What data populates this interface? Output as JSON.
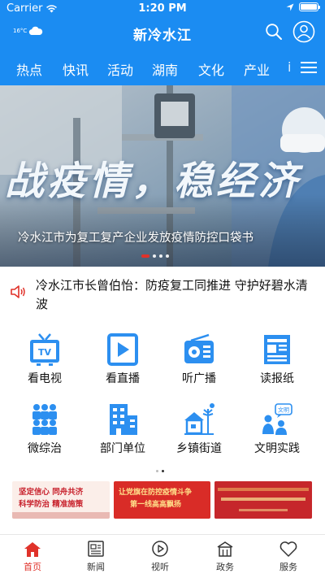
{
  "status_bar": {
    "carrier": "Carrier",
    "time": "1:20 PM",
    "battery_level": 1.0
  },
  "header": {
    "weather_temp": "16°C",
    "title": "新冷水江"
  },
  "tabs": [
    "热点",
    "快讯",
    "活动",
    "湖南",
    "文化",
    "产业",
    "i"
  ],
  "banner": {
    "slogan": "战疫情，稳经济",
    "caption": "冷水江市为复工复产企业发放疫情防控口袋书",
    "slides": 5,
    "active_slide": 1
  },
  "notice": {
    "text": "冷水江市长曾伯怡：防疫复工同推进 守护好碧水清波"
  },
  "grid": [
    {
      "label": "看电视",
      "icon": "tv-icon"
    },
    {
      "label": "看直播",
      "icon": "live-play-icon"
    },
    {
      "label": "听广播",
      "icon": "radio-icon"
    },
    {
      "label": "读报纸",
      "icon": "newspaper-icon"
    },
    {
      "label": "微综治",
      "icon": "people-icon"
    },
    {
      "label": "部门单位",
      "icon": "building-icon"
    },
    {
      "label": "乡镇街道",
      "icon": "town-icon"
    },
    {
      "label": "文明实践",
      "icon": "civilization-icon"
    }
  ],
  "ads": [
    {
      "line1": "坚定信心 同舟共济",
      "line2": "科学防治 精准施策"
    },
    {
      "line1": "让党旗在防控疫情斗争",
      "line2": "第一线高高飘扬"
    },
    {
      "line1": "",
      "line2": ""
    }
  ],
  "bottom_tabs": [
    {
      "label": "首页",
      "active": true
    },
    {
      "label": "新闻",
      "active": false
    },
    {
      "label": "视听",
      "active": false
    },
    {
      "label": "政务",
      "active": false
    },
    {
      "label": "服务",
      "active": false
    }
  ],
  "colors": {
    "primary": "#1b8cf2",
    "accent_red": "#e0322a",
    "icon_blue": "#2c8ff0"
  }
}
